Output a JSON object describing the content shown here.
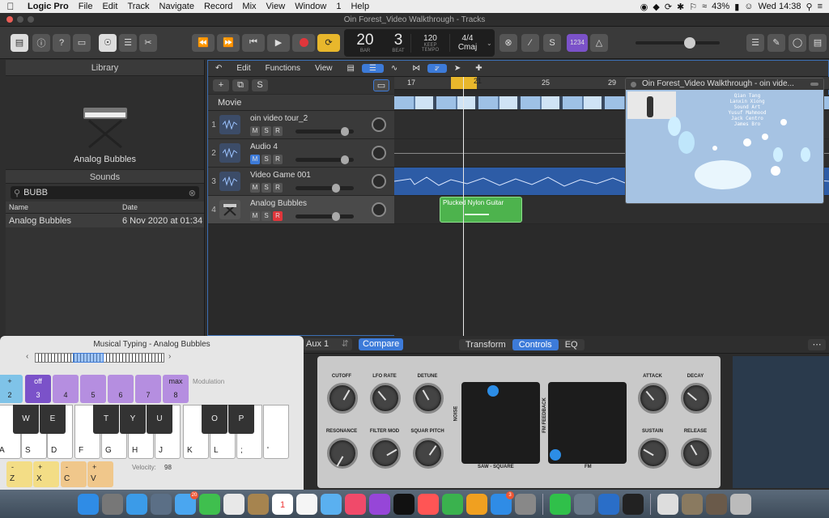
{
  "menubar": {
    "items": [
      "Logic Pro",
      "File",
      "Edit",
      "Track",
      "Navigate",
      "Record",
      "Mix",
      "View",
      "Window",
      "1",
      "Help"
    ],
    "battery": "43%",
    "clock": "Wed 14:38"
  },
  "window": {
    "title": "Oin Forest_Video Walkthrough - Tracks"
  },
  "control_bar": {
    "bar": "20",
    "beat": "3",
    "bar_label": "BAR",
    "beat_label": "BEAT",
    "tempo": "120",
    "tempo_sub": "KEEP",
    "tempo_label": "TEMPO",
    "signature": "4/4",
    "key": "Cmaj",
    "count_in": "1234"
  },
  "library": {
    "header": "Library",
    "instrument": "Analog Bubbles",
    "sounds_header": "Sounds",
    "search_value": "BUBB",
    "col_name": "Name",
    "col_date": "Date",
    "rows": [
      {
        "name": "Analog Bubbles",
        "date": "6 Nov 2020 at 01:34"
      }
    ]
  },
  "tracks_toolbar": {
    "edit": "Edit",
    "functions": "Functions",
    "view": "View"
  },
  "ruler": {
    "marks": [
      "17",
      "21",
      "25",
      "29"
    ]
  },
  "movie_label": "Movie",
  "tracks": [
    {
      "num": "1",
      "name": "oin video tour_2",
      "m": "M",
      "s": "S",
      "r": "R"
    },
    {
      "num": "2",
      "name": "Audio 4",
      "m": "M",
      "s": "S",
      "r": "R"
    },
    {
      "num": "3",
      "name": "Video Game 001",
      "m": "M",
      "s": "S",
      "r": "R"
    },
    {
      "num": "4",
      "name": "Analog Bubbles",
      "m": "M",
      "s": "S",
      "r": "R"
    }
  ],
  "region": {
    "name": "Plucked Nylon Guitar"
  },
  "video": {
    "title": "Oin Forest_Video Walkthrough - oin vide...",
    "credits": [
      "Qian Tang",
      "Lanxin Xiong",
      "Sound Art",
      "Yusuf Mahmood",
      "Jack Centro",
      "James Bro"
    ]
  },
  "musical_typing": {
    "title": "Musical Typing - Analog Bubbles",
    "octave_pads": [
      {
        "top": "+",
        "bottom": "2"
      },
      {
        "top": "off",
        "bottom": "3"
      },
      {
        "top": "",
        "bottom": "4"
      },
      {
        "top": "",
        "bottom": "5"
      },
      {
        "top": "",
        "bottom": "6"
      },
      {
        "top": "",
        "bottom": "7"
      },
      {
        "top": "max",
        "bottom": "8"
      }
    ],
    "modulation": "Modulation",
    "white_keys": [
      "A",
      "S",
      "D",
      "F",
      "G",
      "H",
      "J",
      "K",
      "L",
      ";",
      "'"
    ],
    "black_keys": [
      "W",
      "E",
      "T",
      "Y",
      "U",
      "O",
      "P"
    ],
    "octave_keys": [
      {
        "top": "-",
        "bottom": "Z"
      },
      {
        "top": "+",
        "bottom": "X"
      },
      {
        "top": "-",
        "bottom": "C"
      },
      {
        "top": "+",
        "bottom": "V"
      }
    ],
    "velocity_label": "Velocity:",
    "velocity": "98"
  },
  "plugin": {
    "aux": "Aux 1",
    "compare": "Compare",
    "tabs": [
      "Transform",
      "Controls",
      "EQ"
    ],
    "knobs": [
      "CUTOFF",
      "LFO RATE",
      "DETUNE",
      "RESONANCE",
      "FILTER MOD",
      "SQUAR PITCH",
      "ATTACK",
      "DECAY",
      "SUSTAIN",
      "RELEASE"
    ],
    "xy1_x": "SAW - SQUARE",
    "xy1_y": "NOISE",
    "xy2_x": "FM",
    "xy2_y": "FM FEEDBACK"
  },
  "dock": {
    "badge_mail": "20",
    "calendar_day": "1",
    "badge_appstore": "3"
  },
  "colors": {
    "accent": "#3d7bd9",
    "region": "#4db34d",
    "record": "#e0363b",
    "cycle": "#e8b72c",
    "pad": "#b58ee0"
  }
}
